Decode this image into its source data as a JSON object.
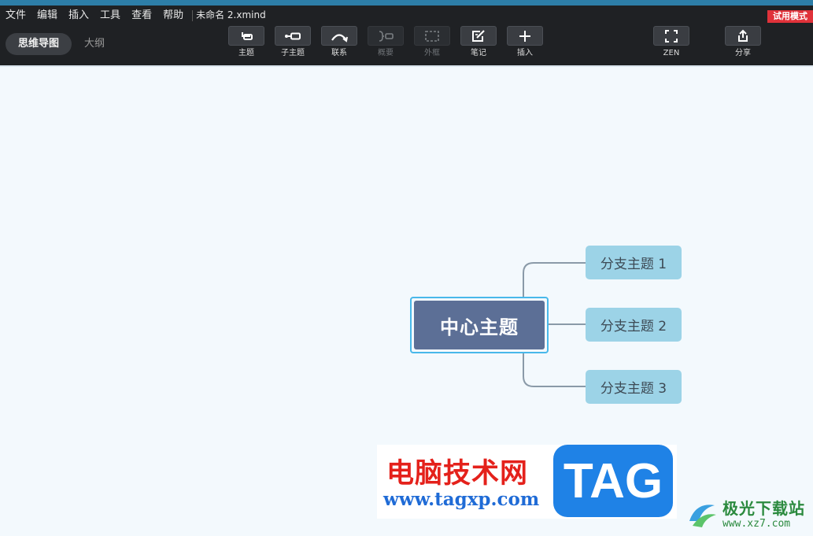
{
  "menu": {
    "items": [
      "文件",
      "编辑",
      "插入",
      "工具",
      "查看",
      "帮助"
    ],
    "doc_title": "未命名 2.xmind",
    "trial_badge": "试用模式"
  },
  "view_switch": {
    "mindmap": "思维导图",
    "outline": "大纲"
  },
  "toolbar": {
    "topic": "主题",
    "subtopic": "子主题",
    "relationship": "联系",
    "summary": "概要",
    "boundary": "外框",
    "note": "笔记",
    "insert": "插入",
    "zen": "ZEN",
    "share": "分享"
  },
  "map": {
    "central": "中心主题",
    "branches": [
      "分支主题 1",
      "分支主题 2",
      "分支主题 3"
    ],
    "colors": {
      "central_fill": "#5c6f96",
      "central_border": "#48b8ea",
      "branch_fill": "#9cd3e7",
      "connector": "#8a9aa8"
    }
  },
  "watermark": {
    "site_name": "电脑技术网",
    "site_url": "www.tagxp.com",
    "badge": "TAG",
    "brand2_name": "极光下载站",
    "brand2_url": "www.xz7.com"
  }
}
